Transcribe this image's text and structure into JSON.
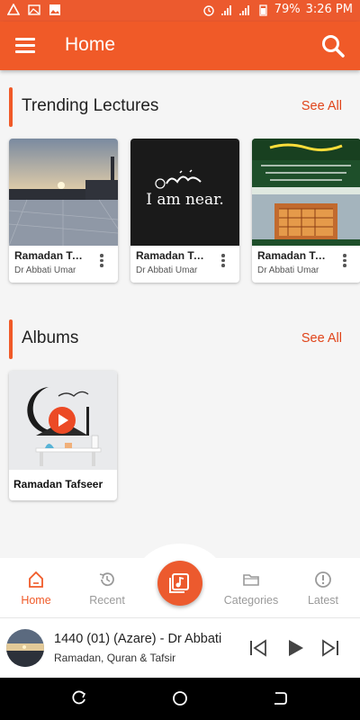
{
  "status_bar": {
    "battery": "79%",
    "time": "3:26 PM"
  },
  "app_bar": {
    "title": "Home"
  },
  "trending": {
    "title": "Trending Lectures",
    "see_all": "See All",
    "items": [
      {
        "title": "Ramadan Tafseer",
        "author": "Dr Abbati Umar"
      },
      {
        "title": "Ramadan Tafseer",
        "author": "Dr Abbati Umar"
      },
      {
        "title": "Ramadan Tafseer",
        "author": "Dr Abbati Umar"
      }
    ],
    "card2_caption": "I am near."
  },
  "albums": {
    "title": "Albums",
    "see_all": "See All",
    "items": [
      {
        "title": "Ramadan Tafseer"
      }
    ]
  },
  "bottom_nav": {
    "items": [
      {
        "label": "Home",
        "icon": "home-icon",
        "active": true
      },
      {
        "label": "Recent",
        "icon": "history-icon",
        "active": false
      },
      {
        "label": "Categories",
        "icon": "folder-icon",
        "active": false
      },
      {
        "label": "Latest",
        "icon": "alert-icon",
        "active": false
      }
    ]
  },
  "player": {
    "title": "1440 (01) (Azare) - Dr Abbati",
    "subtitle": "Ramadan, Quran & Tafsir"
  },
  "colors": {
    "accent": "#f05a28",
    "statusbar": "#ec5a2e"
  }
}
